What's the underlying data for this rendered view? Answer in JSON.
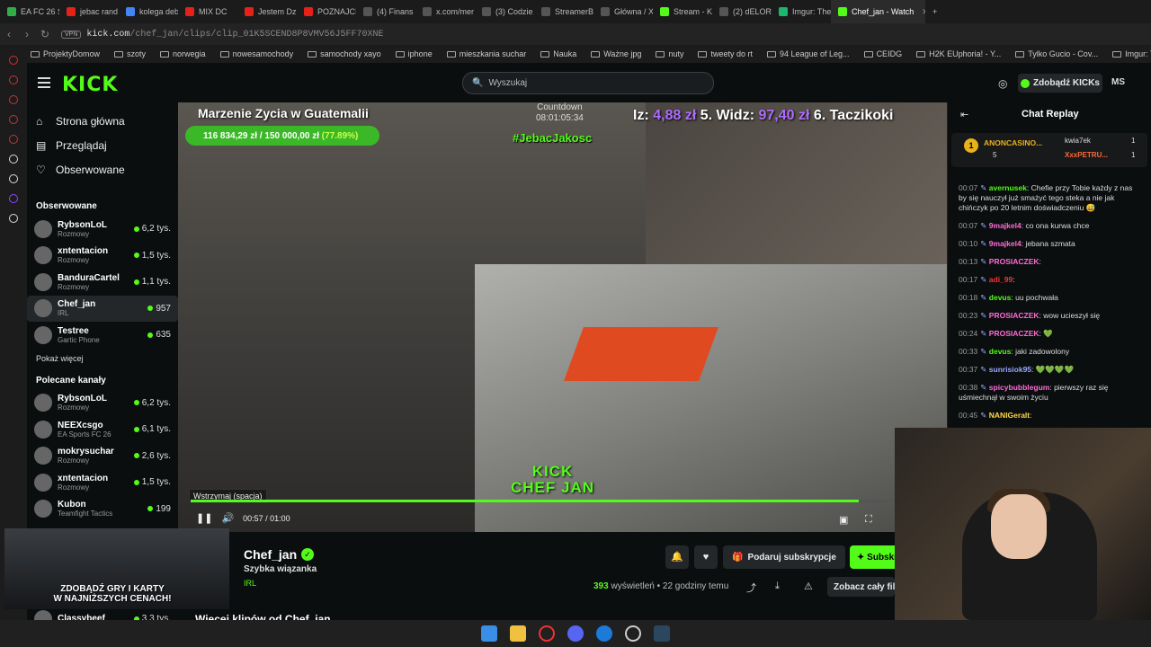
{
  "browser": {
    "tabs": [
      {
        "label": "EA FC 26 S",
        "color": "#2fae47"
      },
      {
        "label": "jebac rand",
        "color": "#e62117"
      },
      {
        "label": "kolega deb",
        "color": "#4285f4"
      },
      {
        "label": "MIX DC",
        "color": "#e62117"
      },
      {
        "label": "Jestem Dz",
        "color": "#e62117"
      },
      {
        "label": "POZNAJCI",
        "color": "#e62117"
      },
      {
        "label": "(4) Finans",
        "color": "#000000"
      },
      {
        "label": "x.com/mer",
        "color": "#000000"
      },
      {
        "label": "(3) Codzie",
        "color": "#000000"
      },
      {
        "label": "StreamerB",
        "color": "#000000"
      },
      {
        "label": "Główna / X",
        "color": "#000000"
      },
      {
        "label": "Stream - K",
        "color": "#53fc18"
      },
      {
        "label": "(2) dELORI",
        "color": "#000000"
      },
      {
        "label": "Imgur: The",
        "color": "#1bb76e"
      },
      {
        "label": "Chef_jan - Watch",
        "color": "#53fc18",
        "active": true
      }
    ],
    "new_tab": "+",
    "vpn": "VPN",
    "url_host": "kick.com",
    "url_path": "/chef_jan/clips/clip_01K5SCEND8P8VMV56J5FF70XNE",
    "bookmarks": [
      "ProjektyDomow",
      "szoty",
      "norwegia",
      "nowesamochody",
      "samochody xayo",
      "iphone",
      "mieszkania suchar",
      "Nauka",
      "Ważne jpg",
      "nuty",
      "tweety do rt",
      "94 League of Leg...",
      "CEIDG",
      "H2K EUphoria! - Y...",
      "Tylko Gucio - Cov...",
      "Imgur: The most a..."
    ]
  },
  "header": {
    "logo": "KICK",
    "search_placeholder": "Wyszukaj",
    "kicks_button": "Zdobądź KICKs",
    "avatar": "MS"
  },
  "sidebar": {
    "nav": [
      {
        "label": "Strona główna",
        "icon": "home-icon"
      },
      {
        "label": "Przeglądaj",
        "icon": "browse-icon"
      },
      {
        "label": "Obserwowane",
        "icon": "heart-icon"
      }
    ],
    "followed_title": "Obserwowane",
    "followed": [
      {
        "name": "RybsonLoL",
        "category": "Rozmowy",
        "viewers": "6,2 tys."
      },
      {
        "name": "xntentacion",
        "category": "Rozmowy",
        "viewers": "1,5 tys."
      },
      {
        "name": "BanduraCartel",
        "category": "Rozmowy",
        "viewers": "1,1 tys."
      },
      {
        "name": "Chef_jan",
        "category": "IRL",
        "viewers": "957"
      },
      {
        "name": "Testree",
        "category": "Gartic Phone",
        "viewers": "635"
      }
    ],
    "show_more": "Pokaż więcej",
    "recommended_title": "Polecane kanały",
    "recommended": [
      {
        "name": "RybsonLoL",
        "category": "Rozmowy",
        "viewers": "6,2 tys."
      },
      {
        "name": "NEEXcsgo",
        "category": "EA Sports FC 26",
        "viewers": "6,1 tys."
      },
      {
        "name": "mokrysuchar",
        "category": "Rozmowy",
        "viewers": "2,6 tys."
      },
      {
        "name": "xntentacion",
        "category": "Rozmowy",
        "viewers": "1,5 tys."
      },
      {
        "name": "Kubon",
        "category": "Teamfight Tactics",
        "viewers": "199"
      },
      {
        "name": "Classybeef",
        "category": "",
        "viewers": "3,3 tys."
      }
    ]
  },
  "video": {
    "overlay_title": "Marzenie Zycia w Guatemalii",
    "goal_current": "116 834,29 zł",
    "goal_target": "150 000,00 zł",
    "goal_percent": "(77.89%)",
    "countdown_label": "Countdown",
    "countdown_value": "08:01:05:34",
    "hashtag": "#JebacJakosc",
    "ranking_prefix": "Iz:",
    "ranking_amount": "4,88 zł",
    "ranking_5": "5. Widz:",
    "ranking_5_amount": "97,40 zł",
    "ranking_6": "6. Taczikoki",
    "watermark_1": "KICK",
    "watermark_2": "CHEF JAN",
    "tooltip": "Wstrzymaj (spacja)",
    "time": "00:57 / 01:00",
    "progress": 0.95
  },
  "clip": {
    "channel": "Chef_jan",
    "title": "Szybka wiązanka",
    "category": "IRL",
    "subscribe_gift": "Podaruj subskrypcje",
    "subscribe": "Subskrybuj",
    "views_count": "393",
    "views_label": "wyświetleń",
    "time_ago": "• 22 godziny temu",
    "see_all": "Zobacz cały film",
    "more_clips": "Więcej klipów od Chef_jan"
  },
  "chat": {
    "title": "Chat Replay",
    "pinned": {
      "top_user": "ANONCASINO...",
      "top_count": "5",
      "user2": "kwia7ek",
      "user2_count": "1",
      "user3": "XxxPETRU...",
      "user3_count": "1"
    },
    "messages": [
      {
        "time": "00:07",
        "user": "avernusek",
        "color": "#53fc18",
        "text": "Chefie przy Tobie każdy z nas by się nauczył już smażyć tego steka a nie jak chińczyk po 20 letnim doświadczeniu 😅"
      },
      {
        "time": "00:07",
        "user": "9majkel4",
        "color": "#ff6bd6",
        "text": "co ona kurwa chce"
      },
      {
        "time": "00:10",
        "user": "9majkel4",
        "color": "#ff6bd6",
        "text": "jebana szmata"
      },
      {
        "time": "00:13",
        "user": "PROSIACZEK",
        "color": "#ff6bd6",
        "text": ""
      },
      {
        "time": "00:17",
        "user": "adi_99",
        "color": "#ff3030",
        "text": ""
      },
      {
        "time": "00:18",
        "user": "devus",
        "color": "#53fc18",
        "text": "uu pochwała"
      },
      {
        "time": "00:23",
        "user": "PROSIACZEK",
        "color": "#ff6bd6",
        "text": "wow ucieszył się"
      },
      {
        "time": "00:24",
        "user": "PROSIACZEK",
        "color": "#ff6bd6",
        "text": "💚"
      },
      {
        "time": "00:33",
        "user": "devus",
        "color": "#53fc18",
        "text": "jaki zadowolony"
      },
      {
        "time": "00:37",
        "user": "sunrisiok95",
        "color": "#9aa7ff",
        "text": "💚💚💚💚"
      },
      {
        "time": "00:38",
        "user": "spicybubblegum",
        "color": "#ff6bd6",
        "text": "pierwszy raz się uśmiechnął w swoim życiu"
      },
      {
        "time": "00:45",
        "user": "NANIGeralt",
        "color": "#ffd84a",
        "text": ""
      }
    ]
  },
  "ad": {
    "line1": "ZDOBĄDŹ GRY I KARTY",
    "line2": "W NAJNIŻSZYCH CENACH!"
  }
}
